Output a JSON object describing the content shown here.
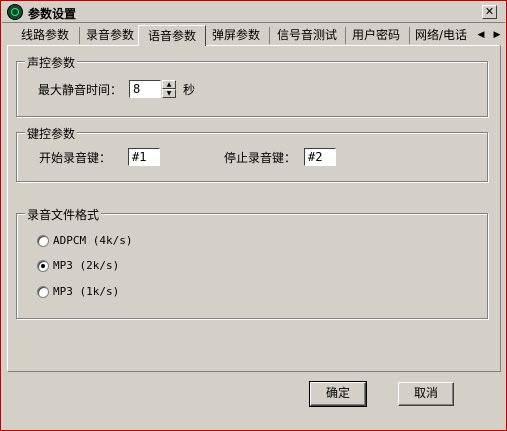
{
  "window": {
    "title": "参数设置",
    "close_label": "✕"
  },
  "tabs": [
    {
      "label": "线路参数",
      "active": false
    },
    {
      "label": "录音参数",
      "active": false
    },
    {
      "label": "语音参数",
      "active": true
    },
    {
      "label": "弹屏参数",
      "active": false
    },
    {
      "label": "信号音测试",
      "active": false
    },
    {
      "label": "用户密码",
      "active": false
    },
    {
      "label": "网络/电话",
      "active": false
    }
  ],
  "tab_scroll": {
    "left": "◀",
    "right": "▶"
  },
  "voice_control": {
    "title": "声控参数",
    "max_silence_label": "最大静音时间：",
    "max_silence_value": "8",
    "unit": "秒",
    "spin_up": "▲",
    "spin_down": "▼"
  },
  "key_control": {
    "title": "键控参数",
    "start_label": "开始录音键：",
    "start_value": "#1",
    "stop_label": "停止录音键：",
    "stop_value": "#2"
  },
  "record_format": {
    "title": "录音文件格式",
    "options": [
      {
        "label": "ADPCM (4k/s)",
        "checked": false
      },
      {
        "label": "MP3 (2k/s)",
        "checked": true
      },
      {
        "label": "MP3 (1k/s)",
        "checked": false
      }
    ]
  },
  "buttons": {
    "ok": "确定",
    "cancel": "取消"
  }
}
